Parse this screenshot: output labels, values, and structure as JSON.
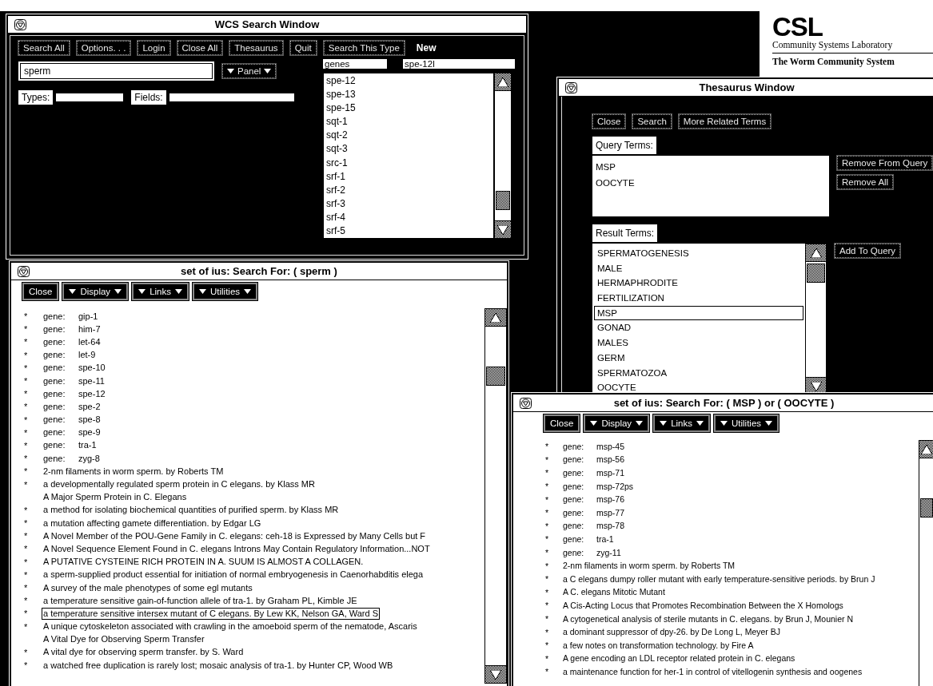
{
  "search_window": {
    "title": "WCS Search Window",
    "buttons": [
      {
        "label": "Search All",
        "kind": "plain"
      },
      {
        "label": "Options. . .",
        "kind": "plain"
      },
      {
        "label": "Login",
        "kind": "plain"
      },
      {
        "label": "Close All",
        "kind": "plain"
      },
      {
        "label": "Thesaurus",
        "kind": "plain"
      },
      {
        "label": "Quit",
        "kind": "plain"
      },
      {
        "label": "Search This Type",
        "kind": "plain"
      },
      {
        "label": "New",
        "kind": "emphasized"
      }
    ],
    "query_field": {
      "value": "sperm"
    },
    "panel_menu": {
      "label": "Panel"
    },
    "types_label": "Types:",
    "fields_label": "Fields:",
    "type_field": {
      "value": "genes"
    },
    "term_field": {
      "value": "spe-12l"
    },
    "terms": [
      "spe-12",
      "spe-13",
      "spe-15",
      "sqt-1",
      "sqt-2",
      "sqt-3",
      "src-1",
      "srf-1",
      "srf-2",
      "srf-3",
      "srf-4",
      "srf-5"
    ]
  },
  "logo": {
    "mark": "CSL",
    "name": "Community Systems Laboratory",
    "subtitle": "The Worm Community System"
  },
  "thesaurus_window": {
    "title": "Thesaurus Window",
    "buttons": [
      "Close",
      "Search",
      "More Related Terms"
    ],
    "query_terms_label": "Query Terms:",
    "query_terms": [
      "MSP",
      "OOCYTE"
    ],
    "query_buttons": [
      "Remove From Query",
      "Remove All"
    ],
    "result_terms_label": "Result Terms:",
    "result_terms": [
      {
        "label": "SPERMATOGENESIS",
        "selected": false
      },
      {
        "label": "MALE",
        "selected": false
      },
      {
        "label": "HERMAPHRODITE",
        "selected": false
      },
      {
        "label": "FERTILIZATION",
        "selected": false
      },
      {
        "label": "MSP",
        "selected": true
      },
      {
        "label": "GONAD",
        "selected": false
      },
      {
        "label": "MALES",
        "selected": false
      },
      {
        "label": "GERM",
        "selected": false
      },
      {
        "label": "SPERMATOZOA",
        "selected": false
      },
      {
        "label": "OOCYTE",
        "selected": false
      }
    ],
    "result_buttons": [
      "Add To Query"
    ]
  },
  "results_windows": [
    {
      "title": "set of ius: Search For: ( sperm )",
      "buttons": [
        {
          "label": "Close",
          "kind": "button"
        },
        {
          "label": "Display",
          "kind": "menu"
        },
        {
          "label": "Links",
          "kind": "menu"
        },
        {
          "label": "Utilities",
          "kind": "menu"
        }
      ],
      "items": [
        {
          "kind": "gene",
          "marker": "*",
          "label": "gene:",
          "value": "gip-1",
          "selected": false
        },
        {
          "kind": "gene",
          "marker": "*",
          "label": "gene:",
          "value": "him-7",
          "selected": false
        },
        {
          "kind": "gene",
          "marker": "*",
          "label": "gene:",
          "value": "let-64",
          "selected": false
        },
        {
          "kind": "gene",
          "marker": "*",
          "label": "gene:",
          "value": "let-9",
          "selected": false
        },
        {
          "kind": "gene",
          "marker": "*",
          "label": "gene:",
          "value": "spe-10",
          "selected": false
        },
        {
          "kind": "gene",
          "marker": "*",
          "label": "gene:",
          "value": "spe-11",
          "selected": false
        },
        {
          "kind": "gene",
          "marker": "*",
          "label": "gene:",
          "value": "spe-12",
          "selected": false
        },
        {
          "kind": "gene",
          "marker": "*",
          "label": "gene:",
          "value": "spe-2",
          "selected": false
        },
        {
          "kind": "gene",
          "marker": "*",
          "label": "gene:",
          "value": "spe-8",
          "selected": false
        },
        {
          "kind": "gene",
          "marker": "*",
          "label": "gene:",
          "value": "spe-9",
          "selected": false
        },
        {
          "kind": "gene",
          "marker": "*",
          "label": "gene:",
          "value": "tra-1",
          "selected": false
        },
        {
          "kind": "gene",
          "marker": "*",
          "label": "gene:",
          "value": "zyg-8",
          "selected": false
        },
        {
          "kind": "title",
          "marker": "*",
          "text": "2-nm filaments in worm sperm. by Roberts TM",
          "selected": false
        },
        {
          "kind": "title",
          "marker": "*",
          "text": "a developmentally regulated sperm protein in C elegans. by Klass MR",
          "selected": false
        },
        {
          "kind": "title",
          "text": "A Major Sperm Protein in C. Elegans",
          "selected": false
        },
        {
          "kind": "title",
          "marker": "*",
          "text": "a method for isolating biochemical quantities of purified sperm. by Klass MR",
          "selected": false
        },
        {
          "kind": "title",
          "marker": "*",
          "text": "a mutation affecting gamete differentiation. by Edgar LG",
          "selected": false
        },
        {
          "kind": "title",
          "marker": "*",
          "text": "A Novel Member of the POU-Gene Family in C. elegans: ceh-18 is Expressed by Many Cells but F",
          "selected": false
        },
        {
          "kind": "title",
          "marker": "*",
          "text": "A Novel Sequence Element Found in C. elegans Introns May Contain Regulatory Information...NOT",
          "selected": false
        },
        {
          "kind": "title",
          "marker": "*",
          "text": "A PUTATIVE CYSTEINE RICH PROTEIN IN A. SUUM IS ALMOST A COLLAGEN.",
          "selected": false
        },
        {
          "kind": "title",
          "marker": "*",
          "text": "a sperm-supplied product essential for initiation of normal embryogenesis in Caenorhabditis elega",
          "selected": false
        },
        {
          "kind": "title",
          "marker": "*",
          "text": "A survey of the male phenotypes of some egl mutants",
          "selected": false
        },
        {
          "kind": "title",
          "marker": "*",
          "text": "a temperature sensitive gain-of-function allele of tra-1. by Graham PL, Kimble JE",
          "selected": false
        },
        {
          "kind": "title",
          "marker": "*",
          "text": "a temperature sensitive intersex mutant of C elegans. By Lew KK, Nelson GA, Ward S",
          "selected": true
        },
        {
          "kind": "title",
          "marker": "*",
          "text": "A unique cytoskeleton associated with crawling in the amoeboid sperm of the nematode, Ascaris",
          "selected": false
        },
        {
          "kind": "title",
          "text": "A Vital Dye for Observing Sperm Transfer",
          "selected": false
        },
        {
          "kind": "title",
          "marker": "*",
          "text": "A vital dye for observing sperm transfer. by S. Ward",
          "selected": false
        },
        {
          "kind": "title",
          "marker": "*",
          "text": "a watched free duplication is rarely lost; mosaic analysis of tra-1. by Hunter CP, Wood WB",
          "selected": false
        }
      ]
    },
    {
      "title": "set of ius: Search For: ( MSP ) or ( OOCYTE )",
      "buttons": [
        {
          "label": "Close",
          "kind": "button"
        },
        {
          "label": "Display",
          "kind": "menu"
        },
        {
          "label": "Links",
          "kind": "menu"
        },
        {
          "label": "Utilities",
          "kind": "menu"
        }
      ],
      "items": [
        {
          "kind": "gene",
          "marker": "*",
          "label": "gene:",
          "value": "msp-45",
          "selected": false
        },
        {
          "kind": "gene",
          "marker": "*",
          "label": "gene:",
          "value": "msp-56",
          "selected": false
        },
        {
          "kind": "gene",
          "marker": "*",
          "label": "gene:",
          "value": "msp-71",
          "selected": false
        },
        {
          "kind": "gene",
          "marker": "*",
          "label": "gene:",
          "value": "msp-72ps",
          "selected": false
        },
        {
          "kind": "gene",
          "marker": "*",
          "label": "gene:",
          "value": "msp-76",
          "selected": false
        },
        {
          "kind": "gene",
          "marker": "*",
          "label": "gene:",
          "value": "msp-77",
          "selected": false
        },
        {
          "kind": "gene",
          "marker": "*",
          "label": "gene:",
          "value": "msp-78",
          "selected": false
        },
        {
          "kind": "gene",
          "marker": "*",
          "label": "gene:",
          "value": "tra-1",
          "selected": false
        },
        {
          "kind": "gene",
          "marker": "*",
          "label": "gene:",
          "value": "zyg-11",
          "selected": false
        },
        {
          "kind": "title",
          "marker": "*",
          "text": "2-nm filaments in worm sperm. by Roberts TM",
          "selected": false
        },
        {
          "kind": "title",
          "marker": "*",
          "text": "a C elegans dumpy roller mutant with early temperature-sensitive periods. by Brun J",
          "selected": false
        },
        {
          "kind": "title",
          "marker": "*",
          "text": "A C. elegans Mitotic Mutant",
          "selected": false
        },
        {
          "kind": "title",
          "marker": "*",
          "text": "A Cis-Acting Locus that Promotes Recombination Between the X Homologs",
          "selected": false
        },
        {
          "kind": "title",
          "marker": "*",
          "text": "A cytogenetical analysis of sterile mutants in C. elegans. by Brun J, Mounier N",
          "selected": false
        },
        {
          "kind": "title",
          "marker": "*",
          "text": "a dominant suppressor of dpy-26. by De Long L, Meyer BJ",
          "selected": false
        },
        {
          "kind": "title",
          "marker": "*",
          "text": "a few notes on transformation technology. by Fire A",
          "selected": false
        },
        {
          "kind": "title",
          "marker": "*",
          "text": "A gene encoding an LDL receptor related protein in C. elegans",
          "selected": false
        },
        {
          "kind": "title",
          "marker": "*",
          "text": "a maintenance function for her-1 in control of vitellogenin synthesis and oogenes",
          "selected": false
        }
      ]
    }
  ]
}
